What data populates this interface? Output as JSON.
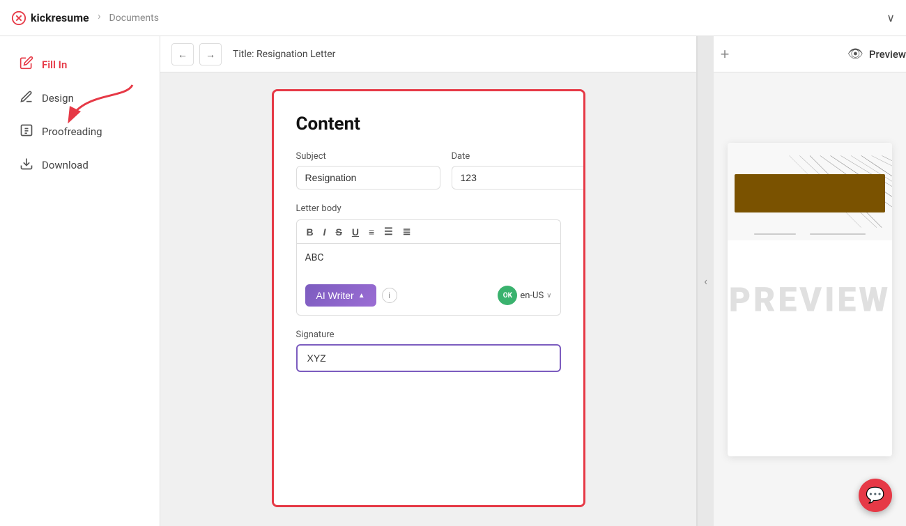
{
  "app": {
    "logo_text": "kickresume",
    "breadcrumb_separator": "‹",
    "breadcrumb_label": "Documents",
    "dropdown_icon": "∨"
  },
  "sidebar": {
    "items": [
      {
        "id": "fill-in",
        "label": "Fill In",
        "icon": "✏️",
        "active": true
      },
      {
        "id": "design",
        "label": "Design",
        "icon": "🖊️",
        "active": false
      },
      {
        "id": "proofreading",
        "label": "Proofreading",
        "icon": "🔍",
        "active": false
      },
      {
        "id": "download",
        "label": "Download",
        "icon": "⬇",
        "active": false
      }
    ]
  },
  "editor": {
    "toolbar": {
      "back_label": "←",
      "forward_label": "→",
      "title": "Title: Resignation Letter",
      "add_label": "+"
    },
    "form": {
      "card_title": "Content",
      "subject_label": "Subject",
      "subject_value": "Resignation",
      "date_label": "Date",
      "date_value": "123",
      "letter_body_label": "Letter body",
      "richtext_buttons": [
        "B",
        "I",
        "S",
        "U",
        "≡",
        "≣",
        "≡"
      ],
      "body_text": "ABC",
      "ai_writer_label": "AI Writer",
      "ai_writer_chevron": "▲",
      "info_icon": "i",
      "ok_badge": "OK",
      "language": "en-US",
      "lang_chevron": "∨",
      "signature_label": "Signature",
      "signature_value": "XYZ"
    }
  },
  "preview": {
    "icon": "👁",
    "label": "Preview",
    "watermark": "PREVIEW",
    "banner_color": "#7a5200"
  },
  "collapse": {
    "icon": "‹"
  },
  "chat": {
    "icon": "💬"
  }
}
